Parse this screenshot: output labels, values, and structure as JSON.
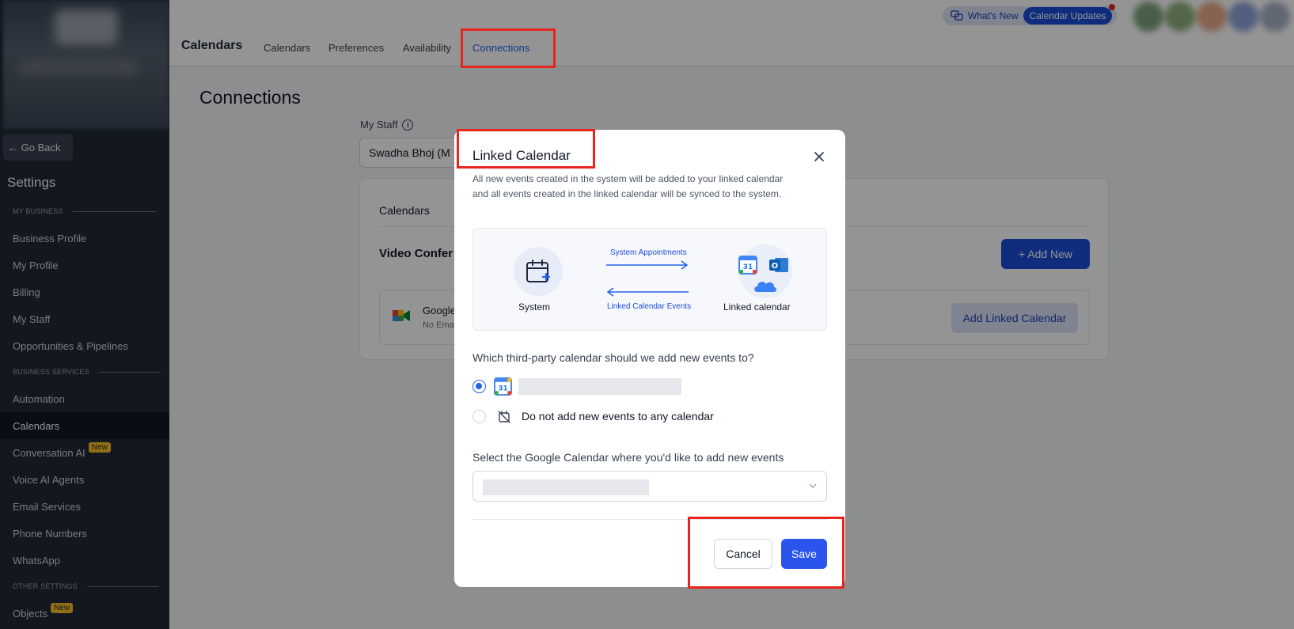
{
  "sidebar": {
    "go_back": "← Go Back",
    "title": "Settings",
    "sections": [
      {
        "label": "MY BUSINESS"
      },
      {
        "label": "BUSINESS SERVICES"
      },
      {
        "label": "OTHER SETTINGS"
      }
    ],
    "items": [
      {
        "label": "Business Profile"
      },
      {
        "label": "My Profile"
      },
      {
        "label": "Billing"
      },
      {
        "label": "My Staff"
      },
      {
        "label": "Opportunities & Pipelines"
      },
      {
        "label": "Automation"
      },
      {
        "label": "Calendars"
      },
      {
        "label": "Conversation AI",
        "badge": "New"
      },
      {
        "label": "Voice AI Agents"
      },
      {
        "label": "Email Services"
      },
      {
        "label": "Phone Numbers"
      },
      {
        "label": "WhatsApp"
      },
      {
        "label": "Objects",
        "badge": "New"
      }
    ]
  },
  "header": {
    "title": "Calendars",
    "tabs": [
      {
        "label": "Calendars"
      },
      {
        "label": "Preferences"
      },
      {
        "label": "Availability"
      },
      {
        "label": "Connections"
      }
    ],
    "whats_new": "What's New",
    "calendar_updates": "Calendar Updates"
  },
  "main": {
    "heading": "Connections",
    "staff_label": "My Staff",
    "staff_value": "Swadha Bhoj (M",
    "card": {
      "calendars_label": "Calendars",
      "video_label": "Video Confer",
      "add_new": "+ Add New",
      "integration_name": "Google",
      "integration_sub": "No Ema",
      "add_linked": "Add Linked Calendar"
    }
  },
  "modal": {
    "title": "Linked Calendar",
    "description": "All new events created in the system will be added to your linked calendar and all events created in the linked calendar will be synced to the system.",
    "system_label": "System",
    "arrow_top_label": "System Appointments",
    "arrow_bottom_label": "Linked Calendar Events",
    "linked_label": "Linked calendar",
    "question": "Which third-party calendar should we add new events to?",
    "option_none": "Do not add new events to any calendar",
    "select_label": "Select the Google Calendar where you'd like to add new events",
    "cancel": "Cancel",
    "save": "Save"
  },
  "colors": {
    "accent": "#2a54eb",
    "highlight": "#e8251c",
    "sidebar_bg": "#1f2937"
  }
}
